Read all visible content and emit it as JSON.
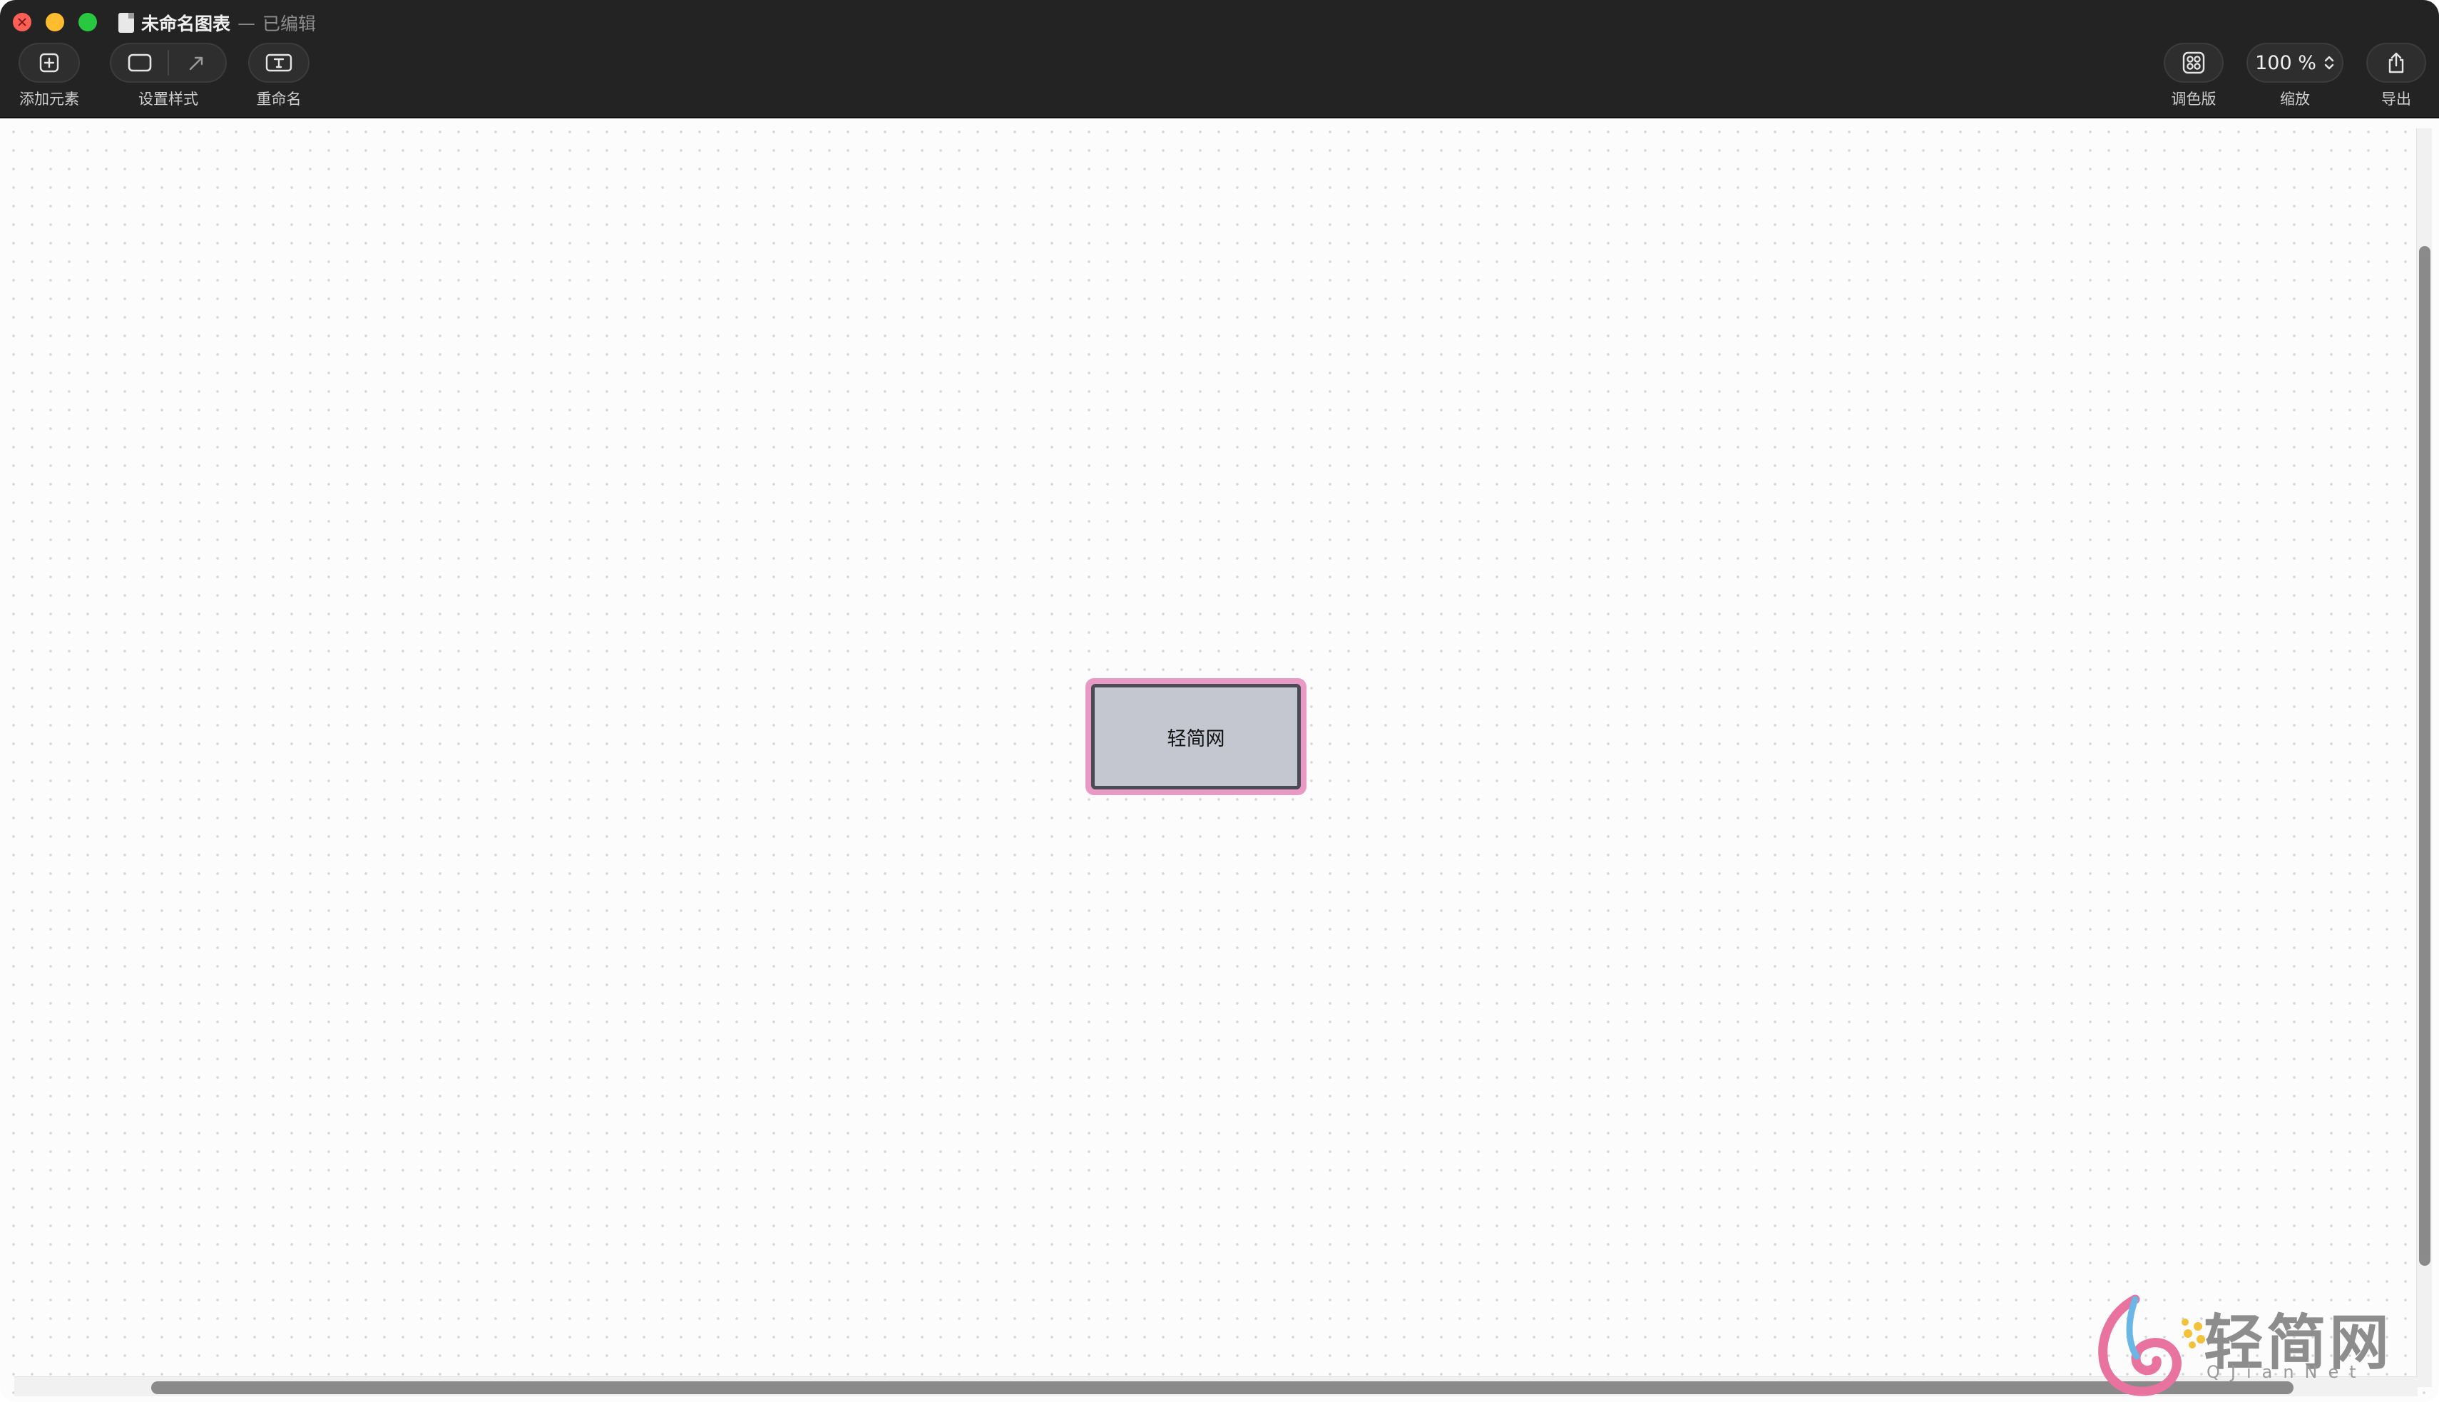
{
  "window": {
    "title": "未命名图表",
    "separator": "—",
    "edit_state": "已编辑"
  },
  "toolbar": {
    "add_element": {
      "label": "添加元素",
      "icon": "plus-icon"
    },
    "set_style": {
      "label": "设置样式",
      "icons": [
        "shape-style-icon",
        "connector-style-icon"
      ]
    },
    "rename": {
      "label": "重命名",
      "icon": "rename-icon"
    },
    "palette": {
      "label": "调色版",
      "icon": "palette-grid-icon"
    },
    "zoom": {
      "label": "缩放",
      "value": "100 %"
    },
    "export": {
      "label": "导出",
      "icon": "share-icon"
    }
  },
  "canvas": {
    "node": {
      "label": "轻简网",
      "fill": "#c4c6d0",
      "border": "#4a4b55",
      "selection": "#e99ac4"
    }
  },
  "watermark": {
    "title": "轻简网",
    "subtitle": "QJianNet"
  },
  "colors": {
    "toolbar_bg": "#232323",
    "canvas_bg": "#fcfcfc",
    "close": "#ff5f57",
    "minimize": "#febc2e",
    "maximize": "#28c840"
  }
}
